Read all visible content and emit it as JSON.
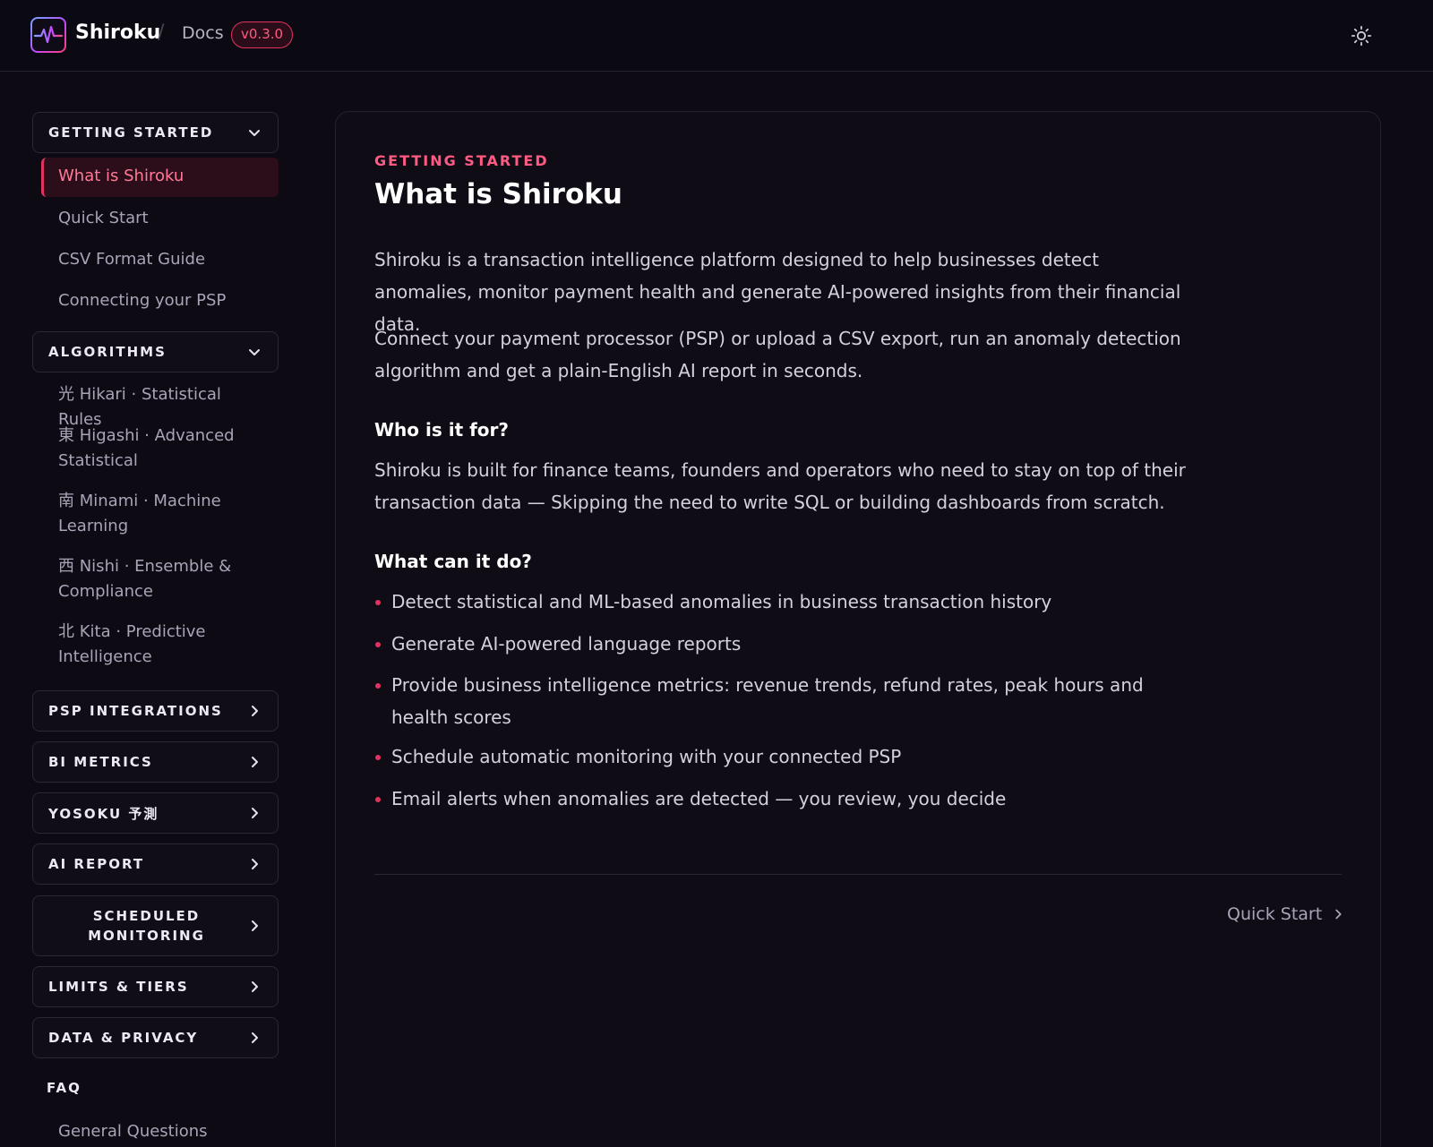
{
  "header": {
    "brand": "Shiroku",
    "separator": "/",
    "docs_label": "Docs",
    "version": "v0.3.0",
    "theme_toggle_icon": "sun-icon"
  },
  "sidebar": {
    "getting_started": {
      "label": "GETTING STARTED",
      "items": [
        "What is Shiroku",
        "Quick Start",
        "CSV Format Guide",
        "Connecting your PSP"
      ]
    },
    "algorithms": {
      "label": "ALGORITHMS",
      "items": [
        "光 Hikari · Statistical Rules",
        "東 Higashi · Advanced Statistical",
        "南 Minami · Machine Learning",
        "西 Nishi · Ensemble & Compliance",
        "北 Kita · Predictive Intelligence"
      ]
    },
    "collapsed_sections": [
      "PSP INTEGRATIONS",
      "BI METRICS",
      "YOSOKU 予測",
      "AI REPORT",
      "SCHEDULED MONITORING",
      "LIMITS & TIERS",
      "DATA & PRIVACY"
    ],
    "faq": {
      "label": "FAQ",
      "items": [
        "General Questions"
      ]
    }
  },
  "content": {
    "eyebrow": "GETTING STARTED",
    "title": "What is Shiroku",
    "intro": "Shiroku is a transaction intelligence platform designed to help businesses detect anomalies, monitor payment health and generate AI-powered insights from their financial data.",
    "connect": "Connect your payment processor (PSP) or upload a CSV export, run an anomaly detection algorithm and get a plain-English AI report in seconds.",
    "who_heading": "Who is it for?",
    "who_text": "Shiroku is built for finance teams, founders and operators who need to stay on top of their transaction data — Skipping the need to write SQL or building dashboards from scratch.",
    "what_heading": "What can it do?",
    "bullets": [
      "Detect statistical and ML-based anomalies in business transaction history",
      "Generate AI-powered language reports",
      "Provide business intelligence metrics: revenue trends, refund rates, peak hours and health scores",
      "Schedule automatic monitoring with your connected PSP",
      "Email alerts when anomalies are detected — you review, you decide"
    ],
    "next_label": "Quick Start"
  }
}
